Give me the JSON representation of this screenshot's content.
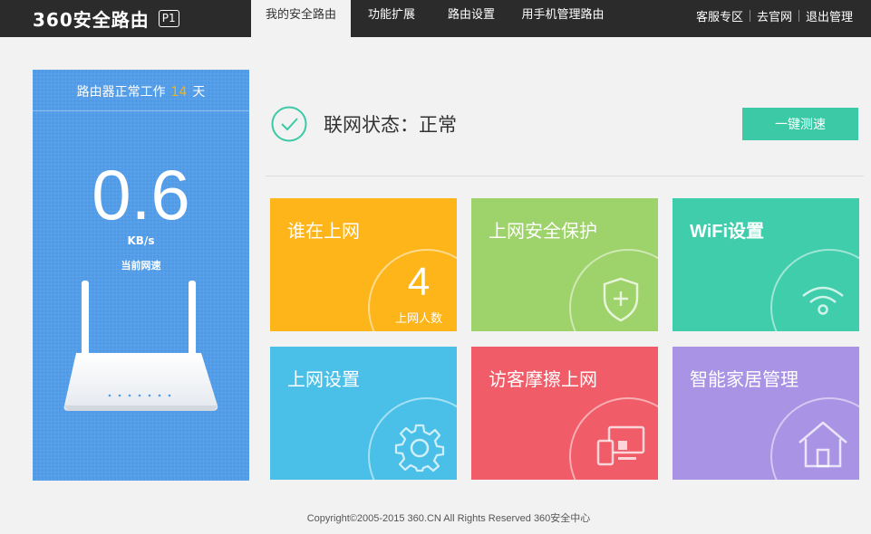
{
  "logo": {
    "text": "360安全路由",
    "model": "P1"
  },
  "nav": {
    "items": [
      "我的安全路由",
      "功能扩展",
      "路由设置",
      "用手机管理路由"
    ]
  },
  "top_links": [
    "客服专区",
    "去官网",
    "退出管理"
  ],
  "status_panel": {
    "uptime_prefix": "路由器正常工作",
    "uptime_days": "14",
    "uptime_suffix": "天",
    "speed_value": "0.6",
    "speed_unit": "KB/s",
    "speed_label": "当前网速"
  },
  "connection": {
    "status_text": "联网状态：正常",
    "speedtest_label": "一键测速"
  },
  "tiles": [
    {
      "title": "谁在上网",
      "count": "4",
      "count_label": "上网人数",
      "color": "#fdb51a"
    },
    {
      "title": "上网安全保护",
      "icon": "shield-plus-icon",
      "color": "#9ed26a"
    },
    {
      "title": "WiFi设置",
      "icon": "wifi-icon",
      "color": "#3fcdab"
    },
    {
      "title": "上网设置",
      "icon": "gear-icon",
      "color": "#4ac0e8"
    },
    {
      "title": "访客摩擦上网",
      "icon": "devices-icon",
      "color": "#f05c68"
    },
    {
      "title": "智能家居管理",
      "icon": "home-icon",
      "color": "#a993e4"
    }
  ],
  "footer": {
    "text": "Copyright©2005-2015 360.CN All Rights Reserved 360安全中心"
  }
}
